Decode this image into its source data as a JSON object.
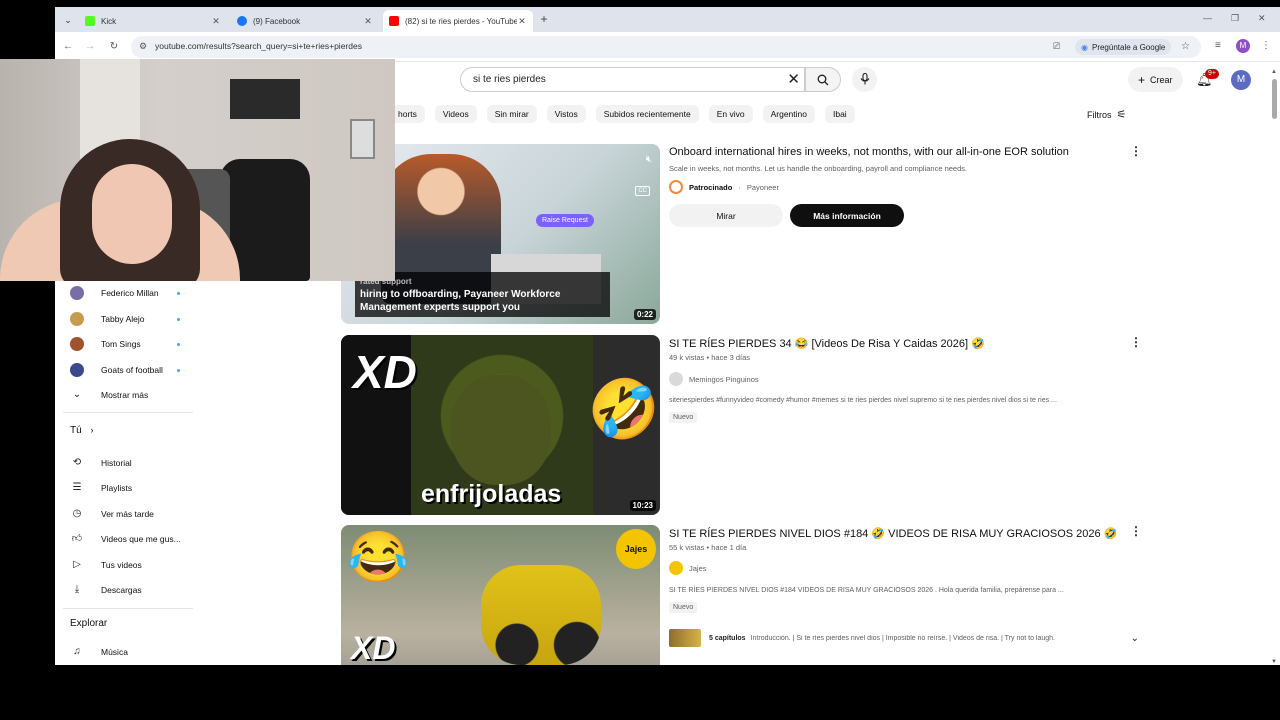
{
  "browser": {
    "tabs": [
      {
        "title": "Kick",
        "favicon_color": "#53fc18"
      },
      {
        "title": "(9) Facebook",
        "favicon_color": "#1877f2"
      },
      {
        "title": "(82) si te ries pierdes - YouTube",
        "favicon_color": "#ff0000"
      }
    ],
    "url": "youtube.com/results?search_query=si+te+ries+pierdes",
    "ask_google": "Pregúntale a Google",
    "profile_letter": "M"
  },
  "youtube": {
    "search_value": "si te ries pierdes",
    "create_label": "Crear",
    "notification_count": "9+",
    "avatar_letter": "M",
    "chips": [
      "horts",
      "Videos",
      "Sin mirar",
      "Vistos",
      "Subidos recientemente",
      "En vivo",
      "Argentino",
      "Ibai"
    ],
    "filters_label": "Filtros"
  },
  "sidebar": {
    "subscriptions": [
      {
        "label": "Federico Millan",
        "avatar_color": "#7b6ea6"
      },
      {
        "label": "Tabby Alejo",
        "avatar_color": "#c59b4f"
      },
      {
        "label": "Tom Sings",
        "avatar_color": "#a0522d"
      },
      {
        "label": "Goats of football",
        "avatar_color": "#3a4a8a"
      }
    ],
    "show_more": "Mostrar más",
    "you_header": "Tú",
    "you_items": [
      {
        "label": "Historial",
        "icon": "history-icon"
      },
      {
        "label": "Playlists",
        "icon": "playlists-icon"
      },
      {
        "label": "Ver más tarde",
        "icon": "watch-later-icon"
      },
      {
        "label": "Videos que me gus...",
        "icon": "liked-icon"
      },
      {
        "label": "Tus videos",
        "icon": "your-videos-icon"
      },
      {
        "label": "Descargas",
        "icon": "downloads-icon"
      }
    ],
    "explore_header": "Explorar",
    "explore_items": [
      {
        "label": "Música",
        "icon": "music-icon"
      }
    ]
  },
  "results": {
    "ad": {
      "title": "Onboard international hires in weeks, not months, with our all-in-one EOR solution",
      "description": "Scale in weeks, not months. Let us handle the onboarding, payroll and compliance needs.",
      "sponsored": "Patrocinado",
      "advertiser": "Payoneer",
      "watch_label": "Mirar",
      "more_info_label": "Más información",
      "duration": "0:22",
      "thumb_caption_top": "rated support",
      "thumb_caption": "hiring to offboarding, Payaneer Workforce Management experts support you",
      "thumb_button": "Raise Request",
      "thumb_cc": "CC"
    },
    "videos": [
      {
        "title": "SI TE RÍES PIERDES 34 😂 [Videos De Risa Y Caidas 2026] 🤣",
        "meta": "49 k vistas • hace 3 días",
        "channel": "Memingos Pinguinos",
        "description": "siteriespierdes #funnyvideo #comedy #humor #memes si te ries pierdes nivel supremo si te ries pierdes nivel dios si te ries ...",
        "badge": "Nuevo",
        "duration": "10:23",
        "thumb_text_top": "XD",
        "thumb_text_bottom": "enfrijoladas",
        "thumb_emoji": "🤣"
      },
      {
        "title": "SI TE RÍES PIERDES NIVEL DIOS #184 🤣 VIDEOS DE RISA MUY GRACIOSOS 2026 🤣",
        "meta": "55 k vistas • hace 1 día",
        "channel": "Jajes",
        "description": "SI TE RÍES PIERDES NIVEL DIOS #184 VIDEOS DE RISA MUY GRACIOSOS 2026 . Hola querida familia, prepárense para ...",
        "badge": "Nuevo",
        "chapters_count": "5 capítulos",
        "chapters_text": "Introducción. | Si te ríes pierdes nivel dios | Imposible no reírse. | Videos de risa. | Try not to laugh.",
        "thumb_text": "XD",
        "thumb_logo": "Jajes",
        "thumb_emoji": "😂"
      }
    ]
  }
}
